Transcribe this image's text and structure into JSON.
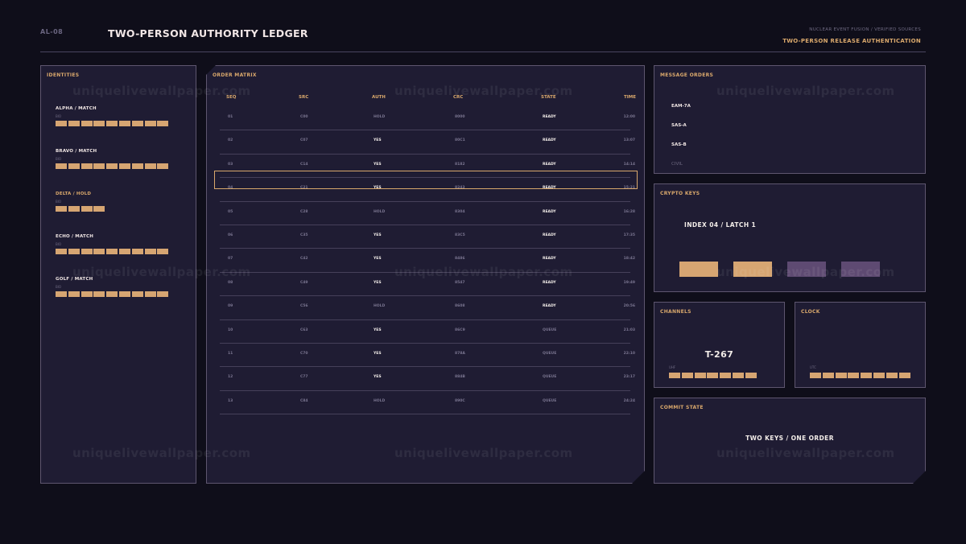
{
  "header": {
    "code": "AL-08",
    "title": "TWO-PERSON AUTHORITY LEDGER",
    "source_line": "NUCLEAR EVENT FUSION / VERIFIED SOURCES",
    "mode_line": "TWO-PERSON RELEASE AUTHENTICATION"
  },
  "identities": {
    "title": "IDENTITIES",
    "items": [
      {
        "label": "ALPHA / MATCH",
        "sub": "BIO",
        "blocks": 9,
        "hold": false
      },
      {
        "label": "BRAVO / MATCH",
        "sub": "BIO",
        "blocks": 9,
        "hold": false
      },
      {
        "label": "DELTA / HOLD",
        "sub": "BIO",
        "blocks": 4,
        "hold": true
      },
      {
        "label": "ECHO / MATCH",
        "sub": "BIO",
        "blocks": 9,
        "hold": false
      },
      {
        "label": "GOLF / MATCH",
        "sub": "BIO",
        "blocks": 9,
        "hold": false
      }
    ]
  },
  "matrix": {
    "title": "ORDER MATRIX",
    "columns": [
      "SEQ",
      "SRC",
      "AUTH",
      "CRC",
      "STATE",
      "TIME"
    ],
    "selected_row": 3,
    "rows": [
      [
        "01",
        "C00",
        "HOLD",
        "8000",
        "READY",
        "12:00"
      ],
      [
        "02",
        "C07",
        "YES",
        "80C1",
        "READY",
        "13:07"
      ],
      [
        "03",
        "C14",
        "YES",
        "8182",
        "READY",
        "14:14"
      ],
      [
        "04",
        "C21",
        "YES",
        "8243",
        "READY",
        "15:21"
      ],
      [
        "05",
        "C28",
        "HOLD",
        "8304",
        "READY",
        "16:28"
      ],
      [
        "06",
        "C35",
        "YES",
        "83C5",
        "READY",
        "17:35"
      ],
      [
        "07",
        "C42",
        "YES",
        "8486",
        "READY",
        "18:42"
      ],
      [
        "08",
        "C49",
        "YES",
        "8547",
        "READY",
        "19:49"
      ],
      [
        "09",
        "C56",
        "HOLD",
        "8608",
        "READY",
        "20:56"
      ],
      [
        "10",
        "C63",
        "YES",
        "86C9",
        "QUEUE",
        "21:03"
      ],
      [
        "11",
        "C70",
        "YES",
        "878A",
        "QUEUE",
        "22:10"
      ],
      [
        "12",
        "C77",
        "YES",
        "884B",
        "QUEUE",
        "23:17"
      ],
      [
        "13",
        "C84",
        "HOLD",
        "890C",
        "QUEUE",
        "24:24"
      ]
    ]
  },
  "message_orders": {
    "title": "MESSAGE ORDERS",
    "items": [
      {
        "label": "EAM-7A",
        "dim": false
      },
      {
        "label": "SAS-A",
        "dim": false
      },
      {
        "label": "SAS-B",
        "dim": false
      },
      {
        "label": "CIVIL",
        "dim": true
      }
    ]
  },
  "crypto_keys": {
    "title": "CRYPTO KEYS",
    "label": "INDEX 04 / LATCH 1",
    "keys": [
      {
        "color": "#d6a572"
      },
      {
        "color": "#d6a572"
      },
      {
        "color": "#5e4a72"
      },
      {
        "color": "#5e4a72"
      }
    ]
  },
  "channels": {
    "title": "CHANNELS",
    "value": "T-267",
    "band": "UHF",
    "blocks": 7
  },
  "clock": {
    "title": "CLOCK",
    "zone": "UTC",
    "blocks": 8
  },
  "commit": {
    "title": "COMMIT STATE",
    "label": "TWO KEYS / ONE ORDER"
  },
  "watermark": "uniquelivewallpaper.com"
}
